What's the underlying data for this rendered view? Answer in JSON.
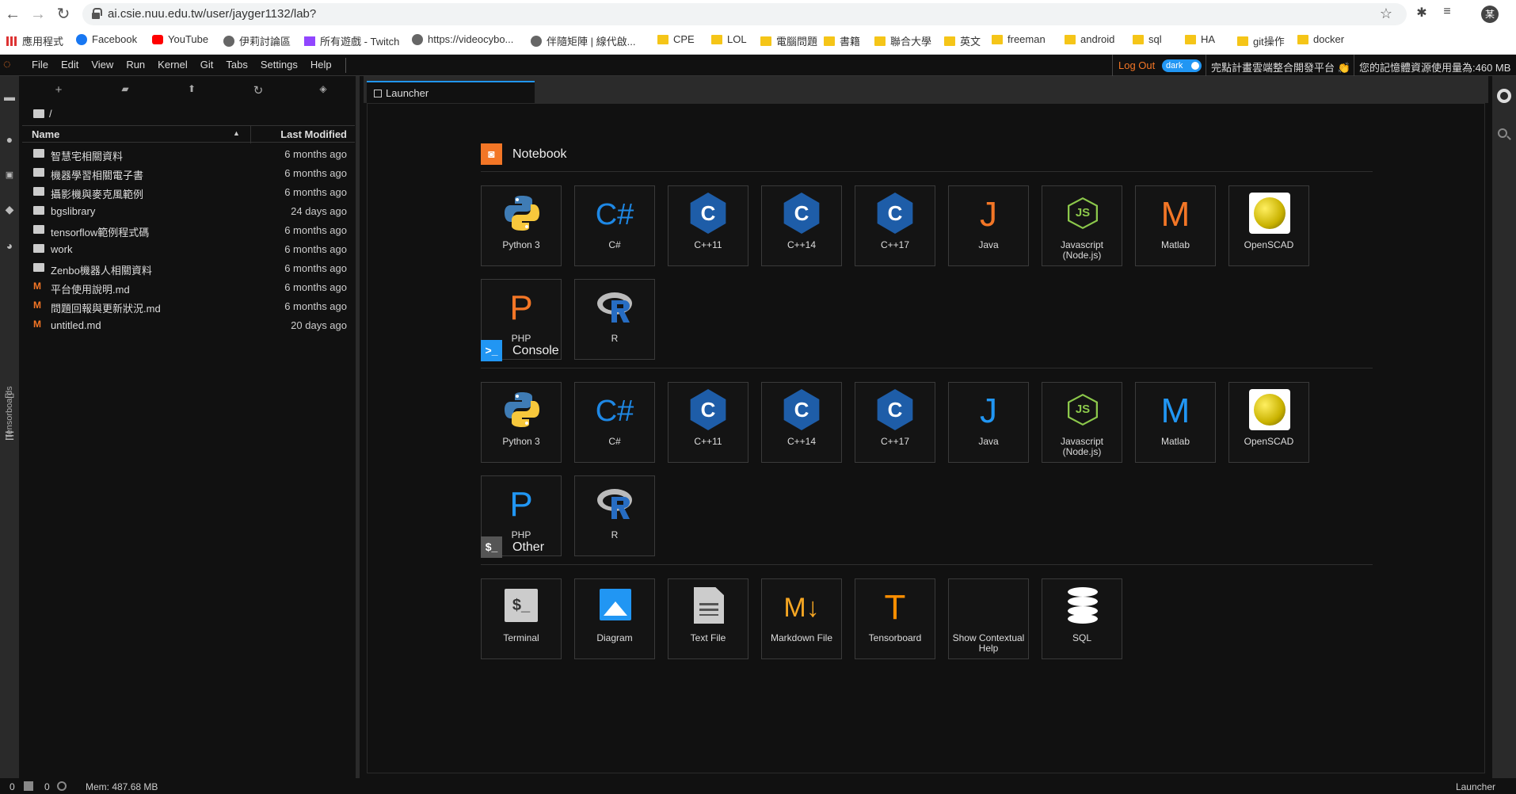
{
  "browser": {
    "url": "ai.csie.nuu.edu.tw/user/jayger1132/lab?",
    "profile_initial": "某",
    "bookmarks": [
      {
        "label": "應用程式",
        "icon": "apps-icon"
      },
      {
        "label": "Facebook",
        "icon": "facebook-icon"
      },
      {
        "label": "YouTube",
        "icon": "youtube-icon"
      },
      {
        "label": "伊莉討論區",
        "icon": "site-icon"
      },
      {
        "label": "所有遊戲 - Twitch",
        "icon": "twitch-icon"
      },
      {
        "label": "https://videocybo...",
        "icon": "site-icon"
      },
      {
        "label": "伴隨矩陣 | 線代啟...",
        "icon": "site-icon"
      },
      {
        "label": "CPE",
        "icon": "folder-icon"
      },
      {
        "label": "LOL",
        "icon": "folder-icon"
      },
      {
        "label": "電腦問題",
        "icon": "folder-icon"
      },
      {
        "label": "書籍",
        "icon": "folder-icon"
      },
      {
        "label": "聯合大學",
        "icon": "folder-icon"
      },
      {
        "label": "英文",
        "icon": "folder-icon"
      },
      {
        "label": "freeman",
        "icon": "folder-icon"
      },
      {
        "label": "android",
        "icon": "folder-icon"
      },
      {
        "label": "sql",
        "icon": "folder-icon"
      },
      {
        "label": "HA",
        "icon": "folder-icon"
      },
      {
        "label": "git操作",
        "icon": "folder-icon"
      },
      {
        "label": "docker",
        "icon": "folder-icon"
      }
    ]
  },
  "jupyter": {
    "menus": [
      "File",
      "Edit",
      "View",
      "Run",
      "Kernel",
      "Git",
      "Tabs",
      "Settings",
      "Help"
    ],
    "logout": "Log Out",
    "theme_toggle": "dark",
    "platform_title": "完點計畫雲端整合開發平台 👏",
    "memory_notice": "您的記憶體資源使用量為:460 MB",
    "sidebar_vertical_label": "Tensorboards"
  },
  "filebrowser": {
    "breadcrumb": "/",
    "col_name": "Name",
    "col_modified": "Last Modified",
    "files": [
      {
        "name": "智慧宅相關資料",
        "type": "folder",
        "modified": "6 months ago"
      },
      {
        "name": "機器學習相關電子書",
        "type": "folder",
        "modified": "6 months ago"
      },
      {
        "name": "攝影機與麥克風範例",
        "type": "folder",
        "modified": "6 months ago"
      },
      {
        "name": "bgslibrary",
        "type": "folder",
        "modified": "24 days ago"
      },
      {
        "name": "tensorflow範例程式碼",
        "type": "folder",
        "modified": "6 months ago"
      },
      {
        "name": "work",
        "type": "folder",
        "modified": "6 months ago"
      },
      {
        "name": "Zenbo機器人相關資料",
        "type": "folder",
        "modified": "6 months ago"
      },
      {
        "name": "平台使用說明.md",
        "type": "markdown",
        "modified": "6 months ago"
      },
      {
        "name": "問題回報與更新狀況.md",
        "type": "markdown",
        "modified": "6 months ago"
      },
      {
        "name": "untitled.md",
        "type": "markdown",
        "modified": "20 days ago"
      }
    ]
  },
  "launcher": {
    "tab_label": "Launcher",
    "sections": [
      {
        "title": "Notebook",
        "icon": "notebook-icon",
        "icon_color": "#f37626",
        "items": [
          {
            "label": "Python 3",
            "icon": "python-icon"
          },
          {
            "label": "C#",
            "icon": "csharp-icon",
            "glyph": "C#",
            "color": "#1e88e5"
          },
          {
            "label": "C++11",
            "icon": "cpp-icon",
            "glyph": "C"
          },
          {
            "label": "C++14",
            "icon": "cpp-icon",
            "glyph": "C"
          },
          {
            "label": "C++17",
            "icon": "cpp-icon",
            "glyph": "C"
          },
          {
            "label": "Java",
            "icon": "java-icon",
            "glyph": "J",
            "color": "#f37626"
          },
          {
            "label": "Javascript (Node.js)",
            "icon": "nodejs-icon",
            "glyph": "JS"
          },
          {
            "label": "Matlab",
            "icon": "matlab-icon",
            "glyph": "M",
            "color": "#f37626"
          },
          {
            "label": "OpenSCAD",
            "icon": "openscad-icon"
          },
          {
            "label": "PHP",
            "icon": "php-icon",
            "glyph": "P",
            "color": "#f37626"
          },
          {
            "label": "R",
            "icon": "r-icon"
          }
        ]
      },
      {
        "title": "Console",
        "icon": "console-icon",
        "icon_color": "#2196f3",
        "items": [
          {
            "label": "Python 3",
            "icon": "python-icon"
          },
          {
            "label": "C#",
            "icon": "csharp-icon",
            "glyph": "C#",
            "color": "#1e88e5"
          },
          {
            "label": "C++11",
            "icon": "cpp-icon",
            "glyph": "C"
          },
          {
            "label": "C++14",
            "icon": "cpp-icon",
            "glyph": "C"
          },
          {
            "label": "C++17",
            "icon": "cpp-icon",
            "glyph": "C"
          },
          {
            "label": "Java",
            "icon": "java-icon",
            "glyph": "J",
            "color": "#2196f3"
          },
          {
            "label": "Javascript (Node.js)",
            "icon": "nodejs-icon",
            "glyph": "JS"
          },
          {
            "label": "Matlab",
            "icon": "matlab-icon",
            "glyph": "M",
            "color": "#2196f3"
          },
          {
            "label": "OpenSCAD",
            "icon": "openscad-icon"
          },
          {
            "label": "PHP",
            "icon": "php-icon",
            "glyph": "P",
            "color": "#2196f3"
          },
          {
            "label": "R",
            "icon": "r-icon"
          }
        ]
      },
      {
        "title": "Other",
        "icon": "terminal-section-icon",
        "icon_color": "#555555",
        "items": [
          {
            "label": "Terminal",
            "icon": "terminal-icon"
          },
          {
            "label": "Diagram",
            "icon": "diagram-icon"
          },
          {
            "label": "Text File",
            "icon": "text-file-icon"
          },
          {
            "label": "Markdown File",
            "icon": "markdown-icon",
            "glyph": "M"
          },
          {
            "label": "Tensorboard",
            "icon": "tensorflow-icon",
            "glyph": "T"
          },
          {
            "label": "Show Contextual Help",
            "icon": "contextual-help-icon"
          },
          {
            "label": "SQL",
            "icon": "database-icon"
          }
        ]
      }
    ]
  },
  "statusbar": {
    "kernels": "0",
    "terminals": "0",
    "memory": "Mem: 487.68 MB",
    "current": "Launcher"
  }
}
